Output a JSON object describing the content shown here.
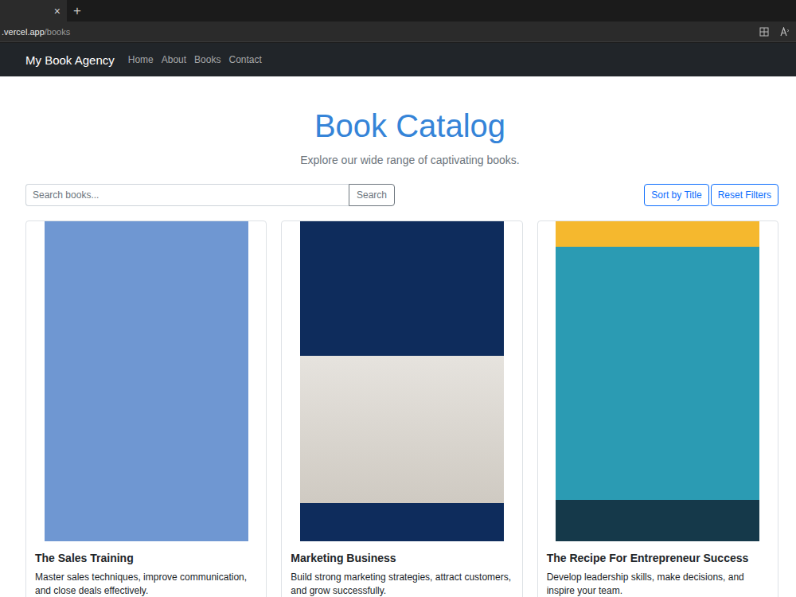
{
  "browser": {
    "tab_close": "×",
    "new_tab": "+",
    "address_host": ".vercel.app",
    "address_path": "/books"
  },
  "navbar": {
    "brand": "My Book Agency",
    "links": [
      {
        "label": "Home"
      },
      {
        "label": "About"
      },
      {
        "label": "Books"
      },
      {
        "label": "Contact"
      }
    ]
  },
  "header": {
    "title": "Book Catalog",
    "subtitle": "Explore our wide range of captivating books."
  },
  "search": {
    "placeholder": "Search books...",
    "button": "Search"
  },
  "buttons": [
    "Sort by Title",
    "Reset Filters"
  ],
  "books": [
    {
      "title": "The Sales Training",
      "description": "Master sales techniques, improve communication, and close deals effectively."
    },
    {
      "title": "Marketing Business",
      "description": "Build strong marketing strategies, attract customers, and grow successfully."
    },
    {
      "title": "The Recipe For Entrepreneur Success",
      "description": "Develop leadership skills, make decisions, and inspire your team."
    }
  ]
}
